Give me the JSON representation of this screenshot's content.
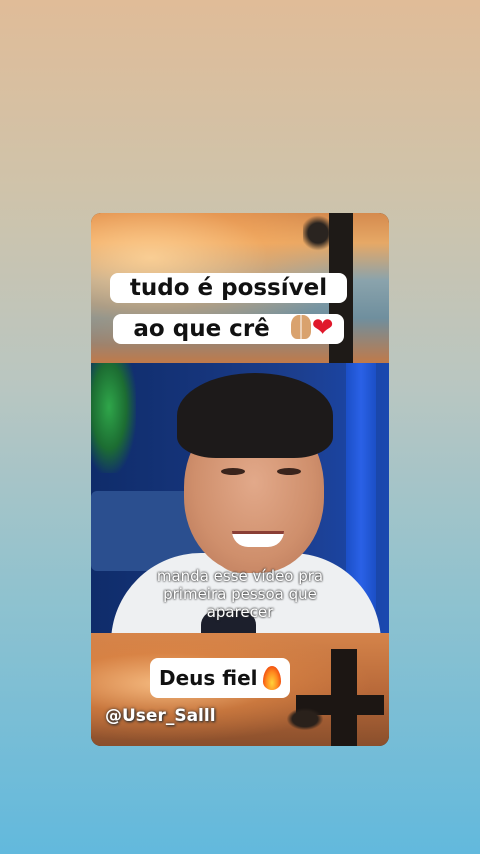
{
  "post": {
    "top_caption": "tudo é possível ao que crê",
    "top_caption_emojis": [
      "praying-hands-emoji",
      "red-heart-emoji"
    ],
    "heart_glyph": "❤",
    "video_overlay_text": "manda esse vídeo pra primeira pessoa que aparecer",
    "bottom_caption": "Deus fiel",
    "bottom_caption_emoji": "fire-emoji",
    "handle": "@User_Salll"
  },
  "colors": {
    "background_top": "#e0bc98",
    "background_bottom": "#62b9dd",
    "caption_bg": "#ffffff",
    "heart": "#e0182b"
  }
}
